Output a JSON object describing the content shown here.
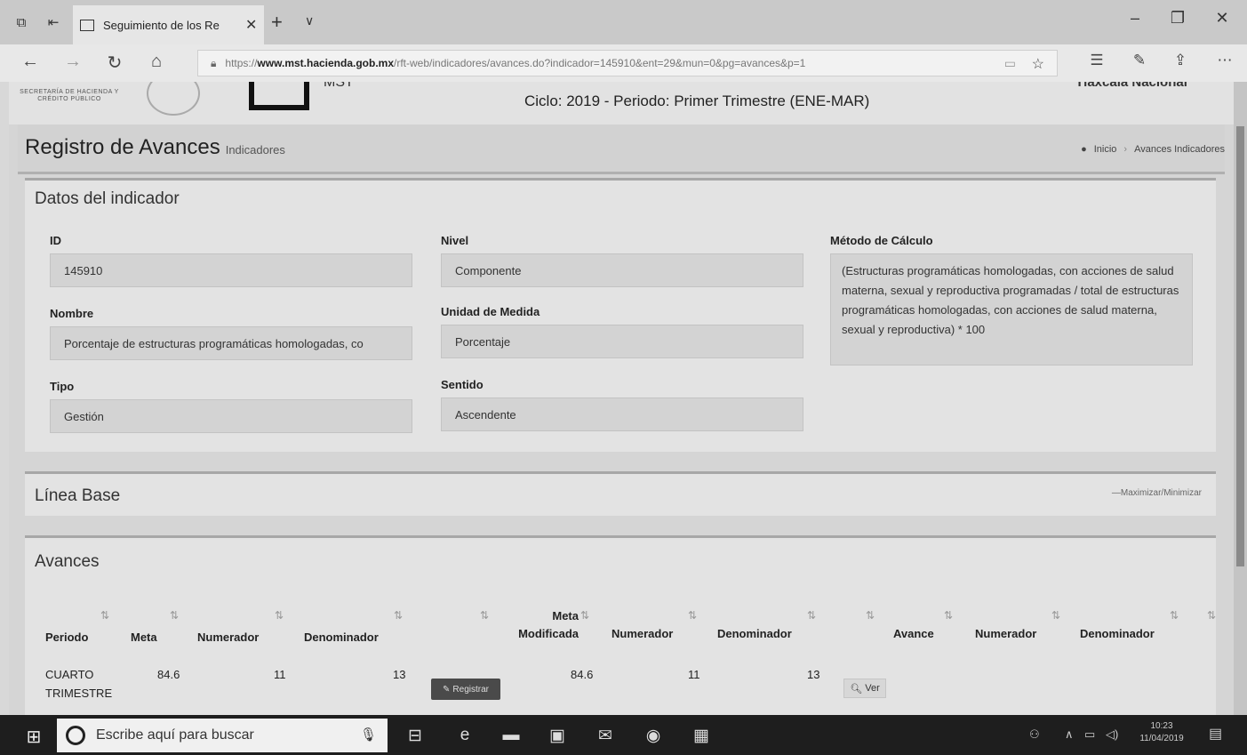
{
  "browser": {
    "tab_title": "Seguimiento de los Re",
    "url_prefix": "https://",
    "url_host": "www.mst.hacienda.gob.mx",
    "url_path": "/rft-web/indicadores/avances.do?indicador=145910&ent=29&mun=0&pg=avances&p=1",
    "icons": [
      "tab-set-aside-icon",
      "tab-preview-icon",
      "page-icon",
      "close-icon",
      "plus-icon",
      "chevron-down-icon",
      "minimize-icon",
      "restore-icon",
      "back-icon",
      "forward-icon",
      "refresh-icon",
      "home-icon",
      "lock-icon",
      "reading-view-icon",
      "favorite-icon",
      "favorites-hub-icon",
      "pen-icon",
      "share-icon",
      "more-icon"
    ]
  },
  "header": {
    "logo_text": "SECRETARÍA DE HACIENDA Y CRÉDITO PÚBLICO",
    "brand_label": "MST",
    "cycle": "Ciclo: 2019 - Periodo: Primer Trimestre (ENE-MAR)",
    "user": "Tlaxcala Nacional"
  },
  "content_header": {
    "title": "Registro de Avances",
    "subtitle": "Indicadores",
    "breadcrumb_home": "Inicio",
    "breadcrumb_current": "Avances Indicadores"
  },
  "indicator": {
    "section_title": "Datos del indicador",
    "id_label": "ID",
    "id_value": "145910",
    "nombre_label": "Nombre",
    "nombre_value": "Porcentaje de estructuras programáticas homologadas, co",
    "tipo_label": "Tipo",
    "tipo_value": "Gestión",
    "nivel_label": "Nivel",
    "nivel_value": "Componente",
    "unidad_label": "Unidad de Medida",
    "unidad_value": "Porcentaje",
    "sentido_label": "Sentido",
    "sentido_value": "Ascendente",
    "metodo_label": "Método de Cálculo",
    "metodo_value": "(Estructuras programáticas homologadas, con acciones de salud materna, sexual y reproductiva programadas / total de estructuras programáticas homologadas, con acciones de salud materna, sexual y reproductiva) * 100"
  },
  "linea_base": {
    "title": "Línea Base",
    "toggle": "Maximizar/Minimizar",
    "toggle_symbol": "—"
  },
  "avances": {
    "title": "Avances",
    "sort_glyph": "⇅",
    "columns": [
      "Periodo",
      "Meta",
      "Numerador",
      "Denominador",
      "",
      "Meta Modificada",
      "Numerador",
      "Denominador",
      "",
      "Avance",
      "Numerador",
      "Denominador",
      ""
    ],
    "row": {
      "periodo": "CUARTO TRIMESTRE",
      "meta": "84.6",
      "numerador": "11",
      "denominador": "13",
      "registrar": "Registrar",
      "meta_modificada": "84.6",
      "numerador_mod": "11",
      "denominador_mod": "13",
      "ver": "Ver"
    }
  },
  "taskbar": {
    "search_placeholder": "Escribe aquí para buscar",
    "time": "10:23",
    "date": "11/04/2019"
  }
}
